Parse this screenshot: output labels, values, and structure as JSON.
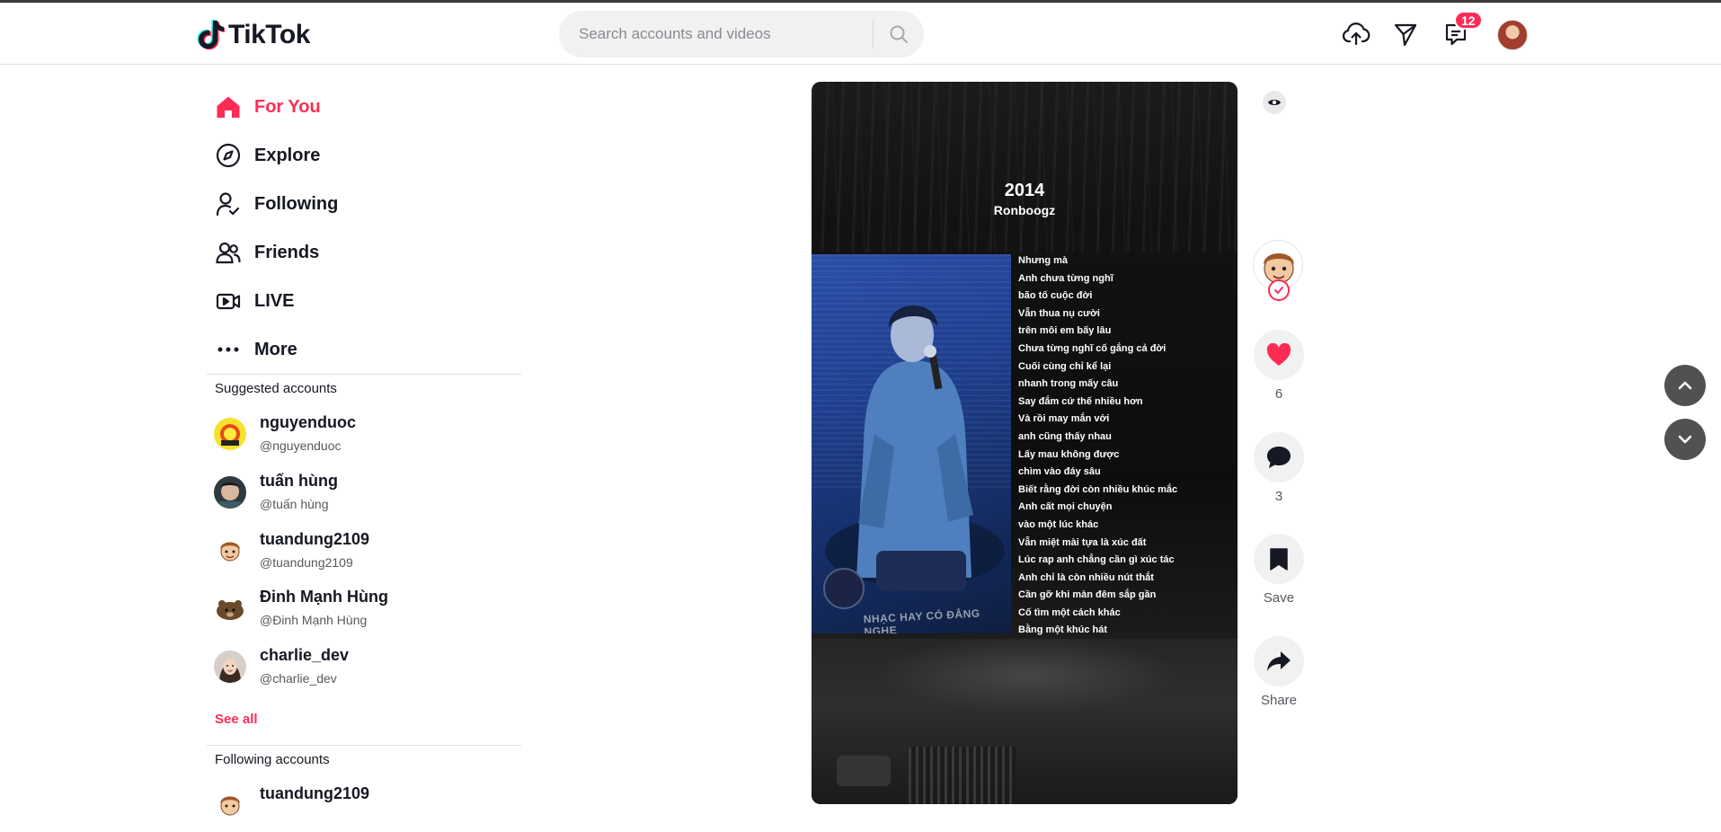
{
  "header": {
    "logo_text": "TikTok",
    "search_placeholder": "Search accounts and videos",
    "inbox_badge": "12",
    "icons": [
      "upload-icon",
      "send-icon",
      "inbox-icon",
      "search-icon"
    ]
  },
  "sidebar": {
    "nav": [
      {
        "label": "For You",
        "icon": "home-icon",
        "active": true
      },
      {
        "label": "Explore",
        "icon": "compass-icon"
      },
      {
        "label": "Following",
        "icon": "following-icon"
      },
      {
        "label": "Friends",
        "icon": "friends-icon"
      },
      {
        "label": "LIVE",
        "icon": "live-icon"
      },
      {
        "label": "More",
        "icon": "more-icon"
      }
    ],
    "suggested_heading": "Suggested accounts",
    "suggested": [
      {
        "name": "nguyenduoc",
        "handle": "@nguyenduoc"
      },
      {
        "name": "tuấn hùng",
        "handle": "@tuấn hùng"
      },
      {
        "name": "tuandung2109",
        "handle": "@tuandung2109"
      },
      {
        "name": "Đinh Mạnh Hùng",
        "handle": "@Đinh Mạnh Hùng"
      },
      {
        "name": "charlie_dev",
        "handle": "@charlie_dev"
      }
    ],
    "see_all": "See all",
    "following_heading": "Following accounts",
    "following": [
      {
        "name": "tuandung2109"
      }
    ]
  },
  "video": {
    "title": "2014",
    "artist": "Ronboogz",
    "watermark": "NHẠC HAY CÓ ĐẲNG NGHE",
    "lyrics": [
      "Nhưng mà",
      "Anh chưa từng nghĩ",
      "bão tố cuộc đời",
      "Vẫn thua nụ cười",
      "trên môi em bấy lâu",
      "Chưa từng nghĩ cố gắng cả đời",
      "Cuối cùng chỉ kể lại",
      "nhanh trong mấy câu",
      "Say đắm cứ thế nhiều hơn",
      "Và rồi may mắn với",
      "anh cũng thấy nhau",
      "Lấy mau không được",
      "chìm vào đáy sâu",
      "Biết rằng đời còn nhiều khúc mắc",
      "Anh cất mọi chuyện",
      "vào một lúc khác",
      "Vẫn miệt mài tựa là xúc đất",
      "Lúc rap anh chẳng cần gì xúc tác",
      "Anh chỉ là còn nhiều nút thắt",
      "Cần gỡ khi màn đêm sắp gần",
      "Cố tìm một cách khác",
      "Bằng một khúc hát"
    ]
  },
  "actions": {
    "likes": "6",
    "comments": "3",
    "save_label": "Save",
    "share_label": "Share"
  },
  "colors": {
    "accent": "#fe2c55",
    "text": "#161823",
    "muted": "#57585e"
  }
}
